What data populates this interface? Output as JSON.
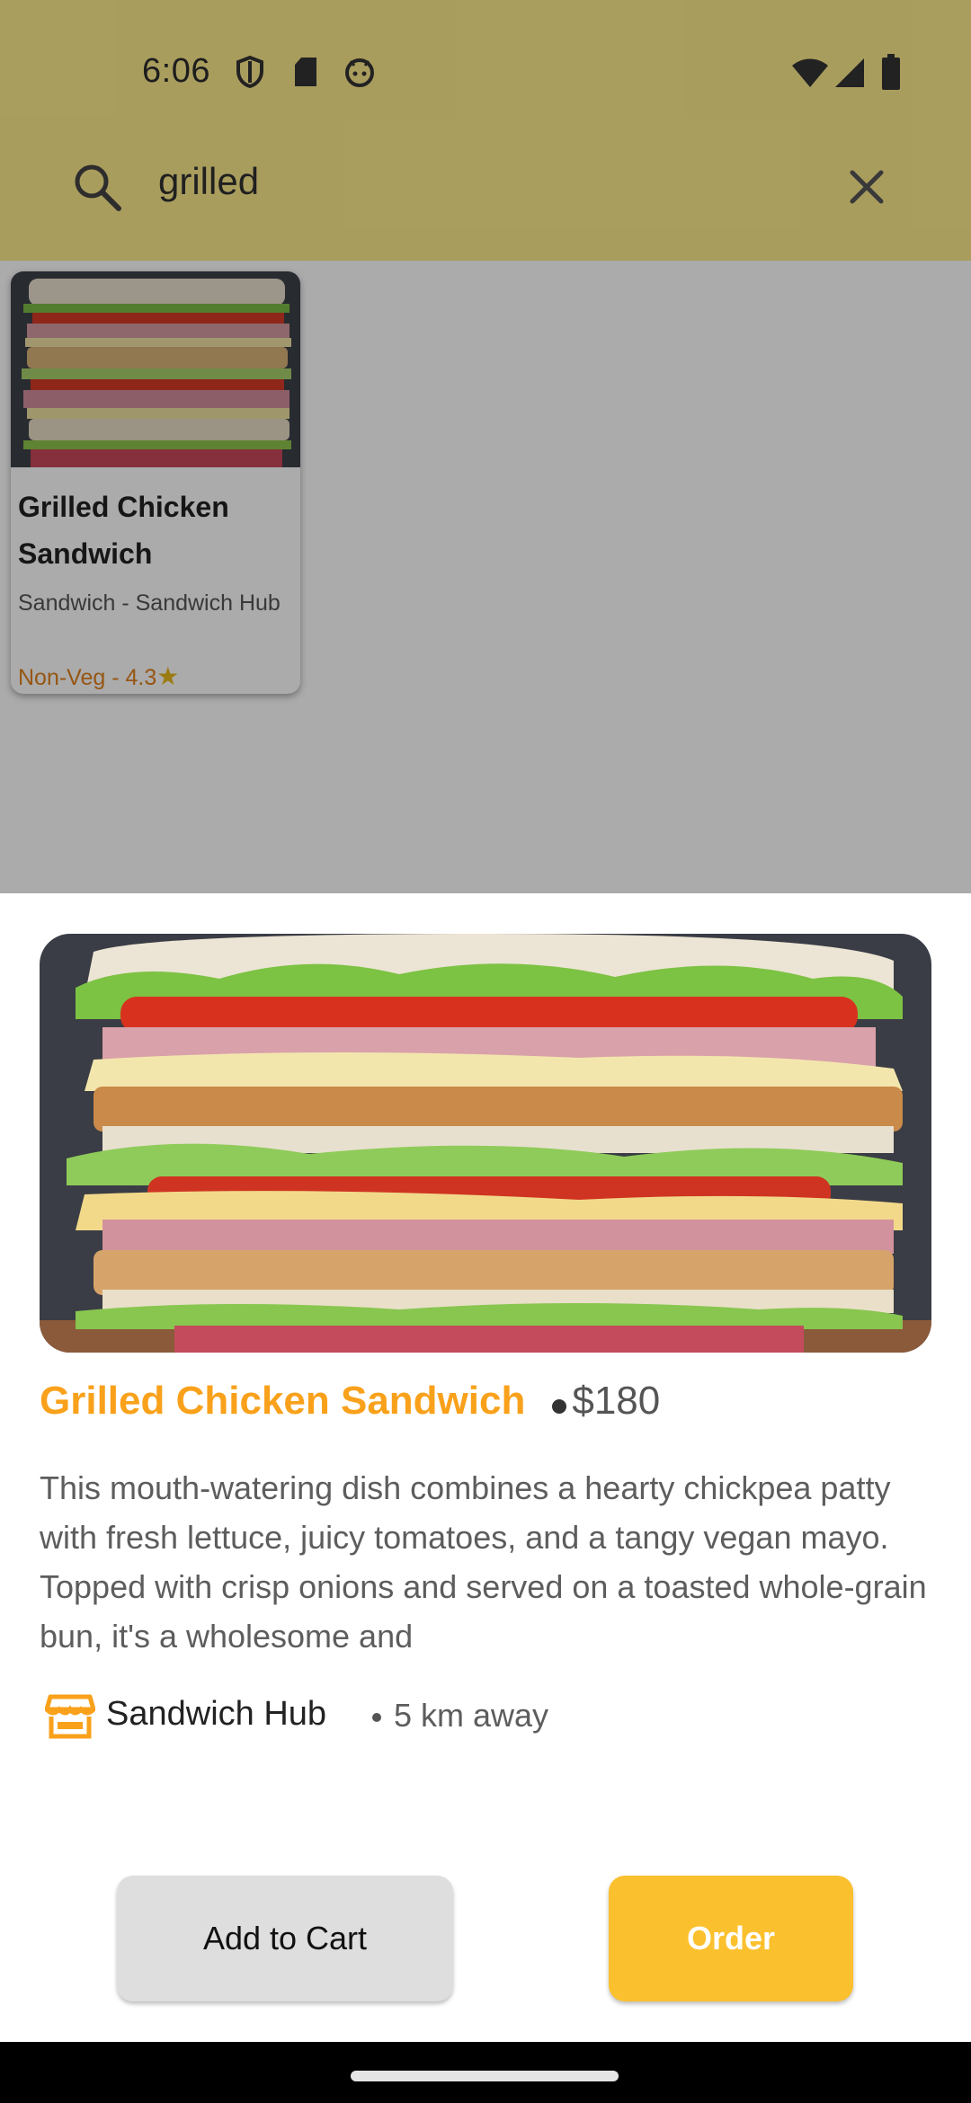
{
  "status_bar": {
    "time": "6:06",
    "icons": [
      "shield-icon",
      "sd-card-icon",
      "android-face-icon",
      "wifi-icon",
      "signal-icon",
      "battery-icon"
    ]
  },
  "search": {
    "query": "grilled",
    "icons": [
      "search-icon",
      "close-icon"
    ]
  },
  "result_card": {
    "title": "Grilled Chicken Sandwich",
    "subtitle": "Sandwich - Sandwich Hub",
    "meta": "Non-Veg - 4.3",
    "rating_icon": "star-icon"
  },
  "detail": {
    "name": "Grilled Chicken Sandwich",
    "price": "$180",
    "description": "This mouth-watering dish combines a hearty chickpea patty with fresh lettuce, juicy tomatoes, and a tangy vegan mayo. Topped with crisp onions and served on a toasted whole-grain bun, it's a wholesome and",
    "store_icon": "storefront-icon",
    "store_name": "Sandwich Hub",
    "distance": "5 km away"
  },
  "actions": {
    "add_to_cart": "Add to Cart",
    "order": "Order"
  },
  "colors": {
    "app_bar": "#FCEB8C",
    "accent_orange": "#F9A11B",
    "order_button": "#FBC02D",
    "cart_button": "#DEDEDE"
  }
}
